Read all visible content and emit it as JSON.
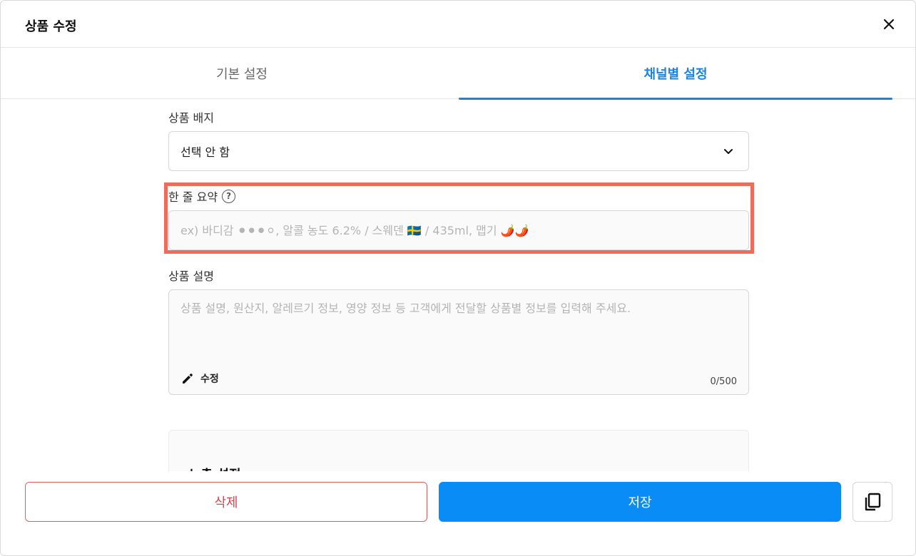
{
  "header": {
    "title": "상품 수정"
  },
  "tabs": [
    {
      "label": "기본 설정",
      "active": false
    },
    {
      "label": "채널별 설정",
      "active": true
    }
  ],
  "badge": {
    "label": "상품 배지",
    "selected": "선택 안 함"
  },
  "summary": {
    "label": "한 줄 요약",
    "help_icon": "?",
    "value": "",
    "placeholder": "ex) 바디감 ⚫⚫⚫⚪, 알콜 농도 6.2% / 스웨덴 🇸🇪 / 435ml, 맵기 🌶️🌶️"
  },
  "description": {
    "label": "상품 설명",
    "value": "",
    "placeholder": "상품 설명, 원산지, 알레르기 정보, 영양 정보 등 고객에게 전달할 상품별 정보를 입력해 주세요.",
    "edit_label": "수정",
    "counter": "0/500"
  },
  "exposure": {
    "title": "노출 설정"
  },
  "footer": {
    "delete_label": "삭제",
    "save_label": "저장"
  },
  "colors": {
    "accent": "#1a84e6",
    "primary_button": "#0a8cf6",
    "danger": "#e0444c",
    "highlight": "#ef6b5c"
  }
}
